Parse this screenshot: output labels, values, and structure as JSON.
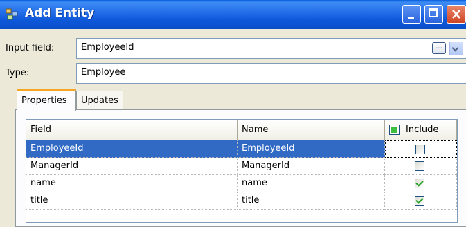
{
  "window": {
    "title": "Add Entity",
    "icon": "app-entity-icon"
  },
  "form": {
    "input_field_label": "Input field:",
    "input_field_value": "EmployeeId",
    "ellipsis_button": "...",
    "type_label": "Type:",
    "type_value": "Employee"
  },
  "tabs": [
    {
      "label": "Properties",
      "active": true
    },
    {
      "label": "Updates",
      "active": false
    }
  ],
  "grid": {
    "columns": [
      "Field",
      "Name",
      "Include"
    ],
    "rows": [
      {
        "field": "EmployeeId",
        "name": "EmployeeId",
        "include": false,
        "selected": true
      },
      {
        "field": "ManagerId",
        "name": "ManagerId",
        "include": false,
        "selected": false
      },
      {
        "field": "name",
        "name": "name",
        "include": true,
        "selected": false
      },
      {
        "field": "title",
        "name": "title",
        "include": true,
        "selected": false
      }
    ]
  },
  "colors": {
    "title_bar": "#0a58d8",
    "selection": "#316ac5",
    "tab_accent": "#f6a623"
  }
}
